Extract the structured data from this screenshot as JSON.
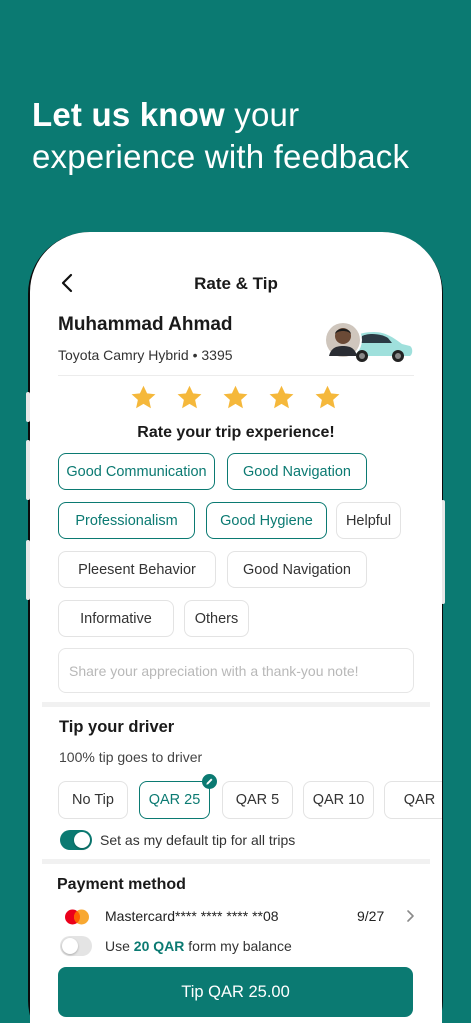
{
  "headline": {
    "bold": "Let us know",
    "rest_line1": " your",
    "line2": "experience with feedback"
  },
  "nav": {
    "title": "Rate & Tip"
  },
  "driver": {
    "name": "Muhammad Ahmad",
    "car": "Toyota Camry Hybrid • 3395"
  },
  "rating": {
    "value": 5,
    "max": 5,
    "label": "Rate your trip experience!"
  },
  "chips": [
    {
      "label": "Good Communication",
      "selected": true
    },
    {
      "label": "Good Navigation",
      "selected": true
    },
    {
      "label": "Professionalism",
      "selected": true
    },
    {
      "label": "Good Hygiene",
      "selected": true
    },
    {
      "label": "Helpful",
      "selected": false
    },
    {
      "label": "Pleesent Behavior",
      "selected": false
    },
    {
      "label": "Good Navigation",
      "selected": false
    },
    {
      "label": "Informative",
      "selected": false
    },
    {
      "label": "Others",
      "selected": false
    }
  ],
  "note": {
    "placeholder": "Share your appreciation with a thank-you note!"
  },
  "tip": {
    "title": "Tip your driver",
    "subtitle": "100% tip goes to driver",
    "options": [
      "No Tip",
      "QAR 25",
      "QAR 5",
      "QAR 10",
      "QAR"
    ],
    "selected": "QAR 25",
    "default_label": "Set as my default tip for all trips",
    "default_on": true
  },
  "payment": {
    "title": "Payment method",
    "card_name": "Mastercard**** **** **** **08",
    "card_expiry": "9/27",
    "balance_prefix": "Use ",
    "balance_amount": "20 QAR",
    "balance_suffix": " form my balance",
    "balance_on": false
  },
  "submit": {
    "label": "Tip QAR 25.00"
  },
  "colors": {
    "brand": "#0b7a72",
    "star": "#f5b83b",
    "mastercard_red": "#eb001b",
    "mastercard_orange": "#f79e1b"
  }
}
